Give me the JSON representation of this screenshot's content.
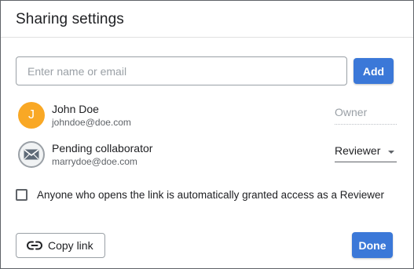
{
  "dialog": {
    "title": "Sharing settings"
  },
  "invite": {
    "placeholder": "Enter name or email",
    "add_label": "Add"
  },
  "people": [
    {
      "name": "John Doe",
      "email": "johndoe@doe.com",
      "avatar_initial": "J",
      "avatar_color": "#f9a825",
      "role": "Owner"
    },
    {
      "name": "Pending collaborator",
      "email": "marrydoe@doe.com",
      "avatar_icon": "envelope-icon",
      "role": "Reviewer"
    }
  ],
  "auto_access": {
    "label": "Anyone who opens the link is automatically granted access as a Reviewer",
    "checked": false
  },
  "footer": {
    "copy_link_label": "Copy link",
    "copy_link_icon": "link-icon",
    "done_label": "Done"
  },
  "colors": {
    "primary": "#3b78d8",
    "text": "#202124",
    "muted": "#9aa0a6"
  }
}
